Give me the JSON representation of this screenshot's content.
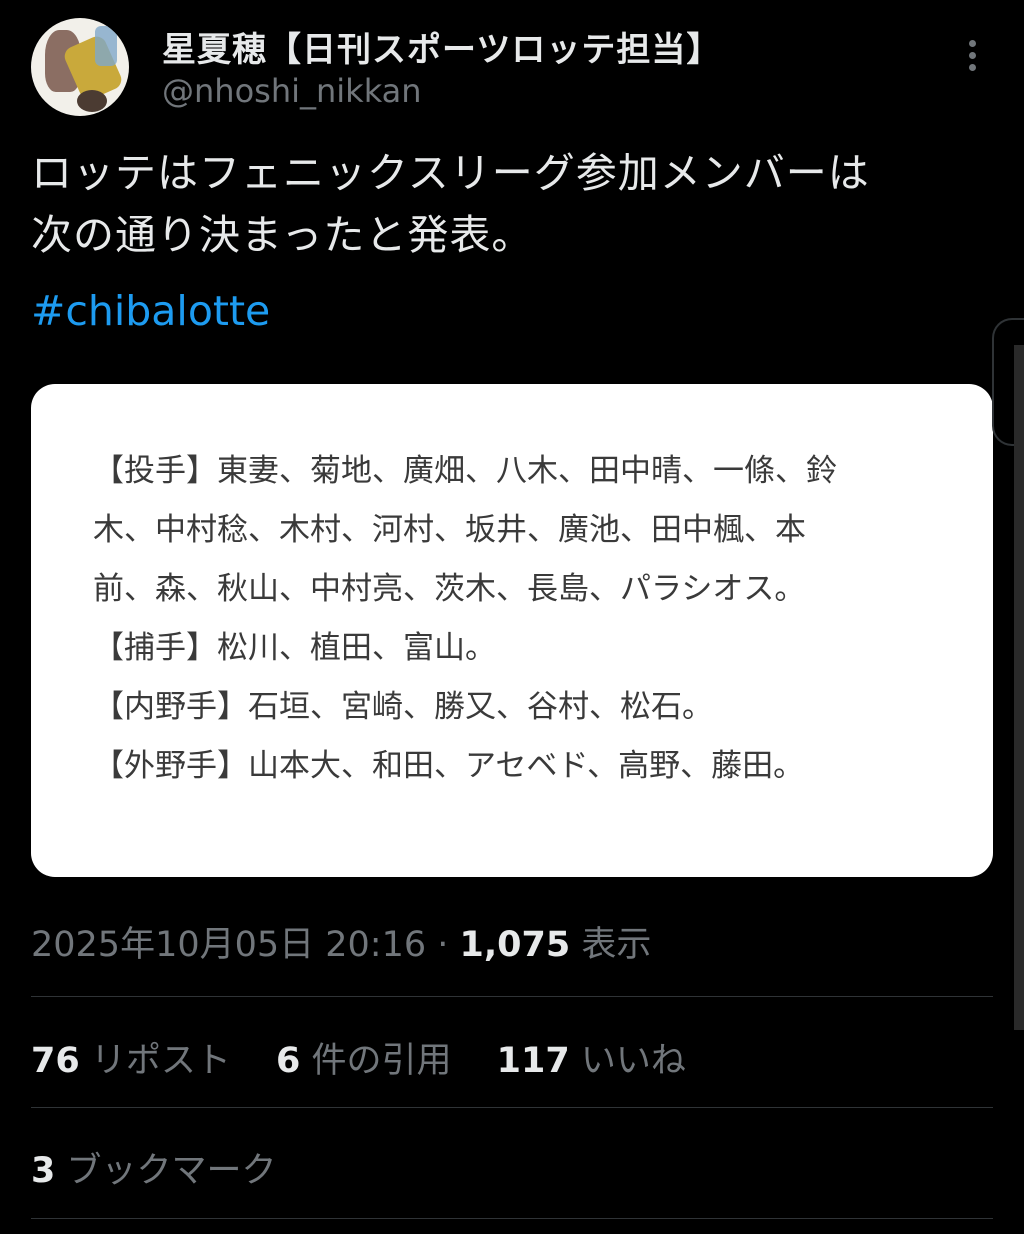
{
  "author": {
    "display_name": "星夏穂【日刊スポーツロッテ担当】",
    "handle": "@nhoshi_nikkan",
    "avatar_icon": "profile-photo"
  },
  "more_icon": "more-vertical-icon",
  "tweet": {
    "text_lines": [
      "ロッテはフェニックスリーグ参加メンバーは",
      "次の通り決まったと発表。"
    ],
    "hashtag": "#chibalotte"
  },
  "media": {
    "roster_lines": [
      "【投手】東妻、菊地、廣畑、八木、田中晴、一條、鈴",
      "木、中村稔、木村、河村、坂井、廣池、田中楓、本",
      "前、森、秋山、中村亮、茨木、長島、パラシオス。",
      "【捕手】松川、植田、富山。",
      "【内野手】石垣、宮崎、勝又、谷村、松石。",
      "【外野手】山本大、和田、アセベド、高野、藤田。"
    ]
  },
  "meta": {
    "datetime": "2025年10月05日 20:16",
    "separator": " · ",
    "views_count": "1,075",
    "views_label": " 表示"
  },
  "stats": {
    "reposts_count": "76",
    "reposts_label": " リポスト",
    "quotes_count": "6",
    "quotes_label": " 件の引用",
    "likes_count": "117",
    "likes_label": " いいね",
    "bookmarks_count": "3",
    "bookmarks_label": " ブックマーク"
  },
  "colors": {
    "background": "#000000",
    "text_primary": "#e7e9ea",
    "text_secondary": "#71767b",
    "link": "#1d9bf0",
    "divider": "#2f3336",
    "card_background": "#ffffff",
    "card_text": "#3a3a3a"
  }
}
